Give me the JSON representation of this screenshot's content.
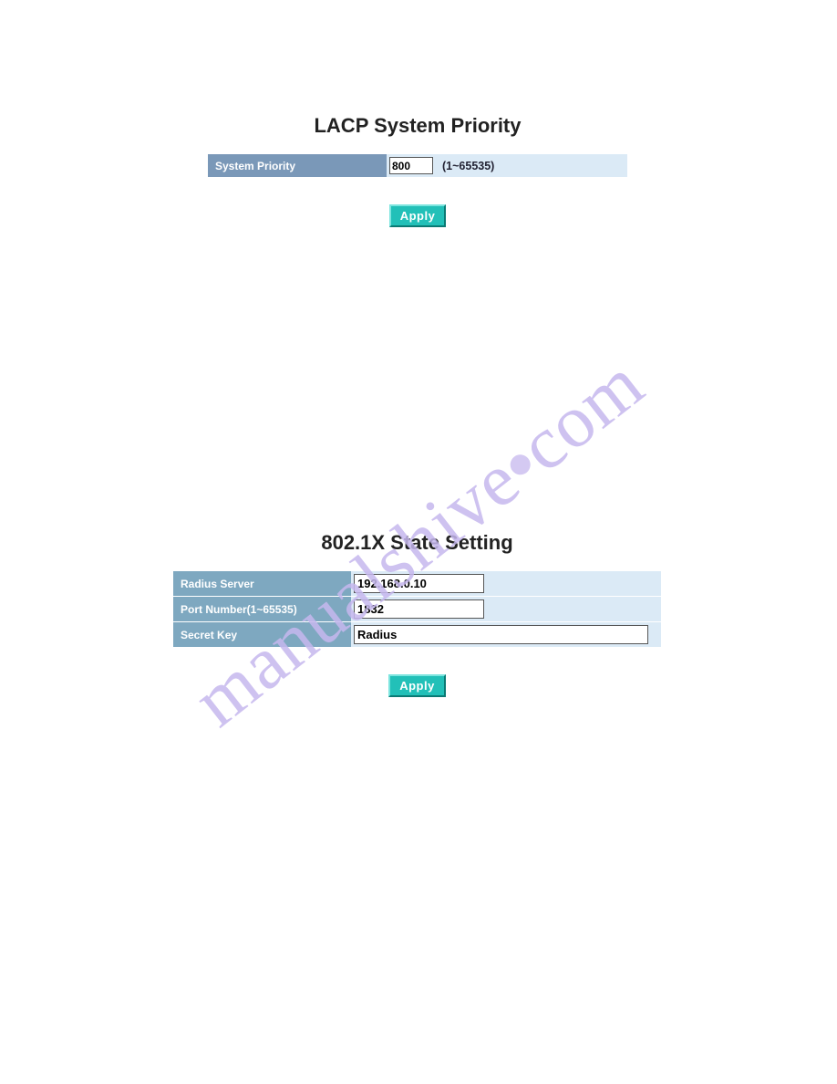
{
  "lacp": {
    "title": "LACP System Priority",
    "field_label": "System Priority",
    "value": "800",
    "range_hint": "(1~65535)",
    "apply_label": "Apply"
  },
  "radius": {
    "title": "802.1X State Setting",
    "server_label": "Radius Server",
    "server_value": "192.168.0.10",
    "port_label": "Port Number(1~65535)",
    "port_value": "1832",
    "key_label": "Secret Key",
    "key_value": "Radius",
    "apply_label": "Apply"
  },
  "watermark": "manualshive.com"
}
